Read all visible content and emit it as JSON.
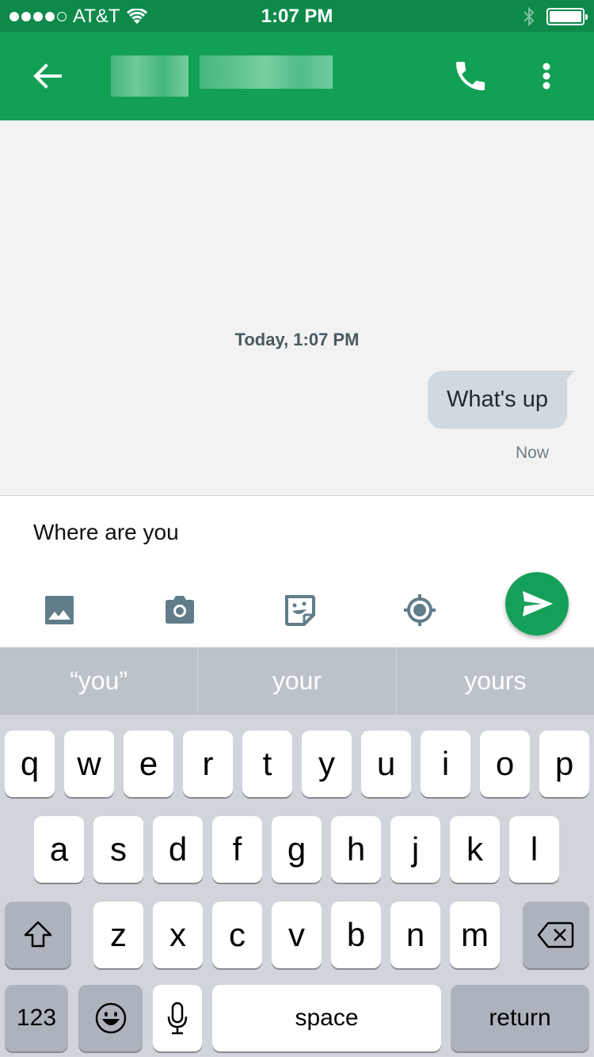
{
  "status_bar": {
    "carrier": "AT&T",
    "time": "1:07 PM",
    "signal_bars_filled": 4,
    "signal_bars_total": 5,
    "icons": [
      "signal-dots-icon",
      "wifi-icon",
      "bluetooth-icon",
      "battery-icon"
    ],
    "battery_level": 1.0
  },
  "app_bar": {
    "back_icon": "arrow-left-icon",
    "title": null,
    "title_redacted": true,
    "actions": [
      "phone-icon",
      "more-vertical-icon"
    ],
    "color": "#12a055"
  },
  "conversation": {
    "date_stamp": "Today, 1:07 PM",
    "messages": [
      {
        "text": "What's up",
        "direction": "outgoing",
        "time": "Now"
      }
    ]
  },
  "composer": {
    "input_value": "Where are you",
    "tools": [
      "image-icon",
      "camera-icon",
      "sticker-icon",
      "location-icon"
    ],
    "send_icon": "send-icon",
    "send_color": "#15a05a"
  },
  "keyboard": {
    "suggestions": [
      "“you”",
      "your",
      "yours"
    ],
    "row1": [
      "q",
      "w",
      "e",
      "r",
      "t",
      "y",
      "u",
      "i",
      "o",
      "p"
    ],
    "row2": [
      "a",
      "s",
      "d",
      "f",
      "g",
      "h",
      "j",
      "k",
      "l"
    ],
    "row3": [
      "z",
      "x",
      "c",
      "v",
      "b",
      "n",
      "m"
    ],
    "numbers_label": "123",
    "space_label": "space",
    "return_label": "return"
  }
}
